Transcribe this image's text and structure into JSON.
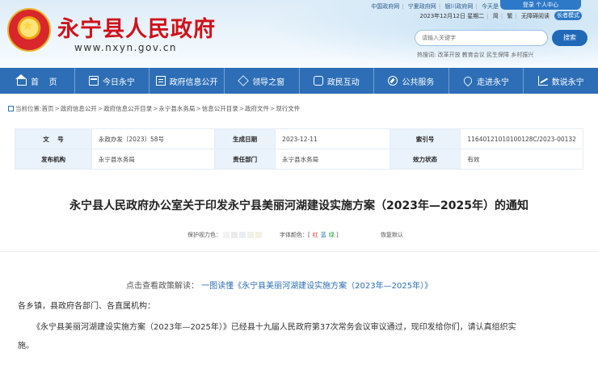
{
  "header": {
    "site_title": "永宁县人民政府",
    "site_url": "www.nxyn.gov.cn",
    "top_links": [
      "中国政府网",
      "宁夏政府网",
      "银川政府网",
      "今天是"
    ],
    "login_label": "登录 个人中心",
    "date_text": "2023年12月12日 星期二",
    "access_links": [
      "简",
      "繁",
      "无障碍阅读"
    ],
    "elder_label": "长者模式",
    "search_placeholder": "请输入关键字",
    "search_label": "搜索",
    "hot_words": "热搜词: 改革开放 教育会议 民生保障 乡村振兴"
  },
  "nav": {
    "items": [
      {
        "label": "首    页",
        "icon": "home-icon"
      },
      {
        "label": "今日永宁",
        "icon": "calendar-icon"
      },
      {
        "label": "政府信息公开",
        "icon": "document-icon"
      },
      {
        "label": "领导之窗",
        "icon": "gem-icon"
      },
      {
        "label": "政民互动",
        "icon": "chat-icon"
      },
      {
        "label": "公共服务",
        "icon": "compass-icon"
      },
      {
        "label": "走进永宁",
        "icon": "location-icon"
      },
      {
        "label": "数说永宁",
        "icon": "trend-icon"
      }
    ]
  },
  "breadcrumb": {
    "prefix": "当前位置:",
    "items": [
      "首页",
      "政府信息公开",
      "政府信息公开目录",
      "永宁县水务局",
      "信息公开目录",
      "政府文件",
      "现行文件"
    ]
  },
  "info_table": {
    "rows": [
      [
        {
          "label": "文    号",
          "value": "永政办发〔2023〕58号"
        },
        {
          "label": "生成日期",
          "value": "2023-12-11"
        },
        {
          "label": "索引号",
          "value": "116401210101001​28C/2023-00132"
        }
      ],
      [
        {
          "label": "发布机构",
          "value": "永宁县水务局"
        },
        {
          "label": "责任部门",
          "value": "永宁县水务局"
        },
        {
          "label": "效力状态",
          "value": "有效"
        }
      ]
    ]
  },
  "doc_title": "永宁县人民政府办公室关于印发永宁县美丽河湖建设实施方案（2023年—2025年）的通知",
  "tools": {
    "protect_label": "保护视力色：",
    "protect_colors": [
      "#f2f2f2",
      "#ececec",
      "#e9eef2",
      "#eef3e6",
      "#f4f0e2"
    ],
    "font_color_label": "字体颜色：",
    "font_colors": [
      {
        "name": "红",
        "color": "#e0302b"
      },
      {
        "name": "蓝",
        "color": "#2d6eb6"
      },
      {
        "name": "绿",
        "color": "#2f9a3c"
      }
    ],
    "restore_label": "恢复默认"
  },
  "body": {
    "reading_label": "点击查看政策解读：",
    "reading_link": "一图读懂《永宁县美丽河湖建设实施方案（2023年—2025年）》",
    "para1": "各乡镇，县政府各部门、各直属机构：",
    "para2": "《永宁县美丽河湖建设实施方案（2023年—2025年）》已经县十九届人民政府第37次常务会议审议通过，现印发给你们，请认真组织实",
    "para3": "施。"
  },
  "colors": {
    "brand_red": "#d0121b",
    "nav_blue": "#2d6eb6",
    "label_bg": "#eaf2fb"
  }
}
